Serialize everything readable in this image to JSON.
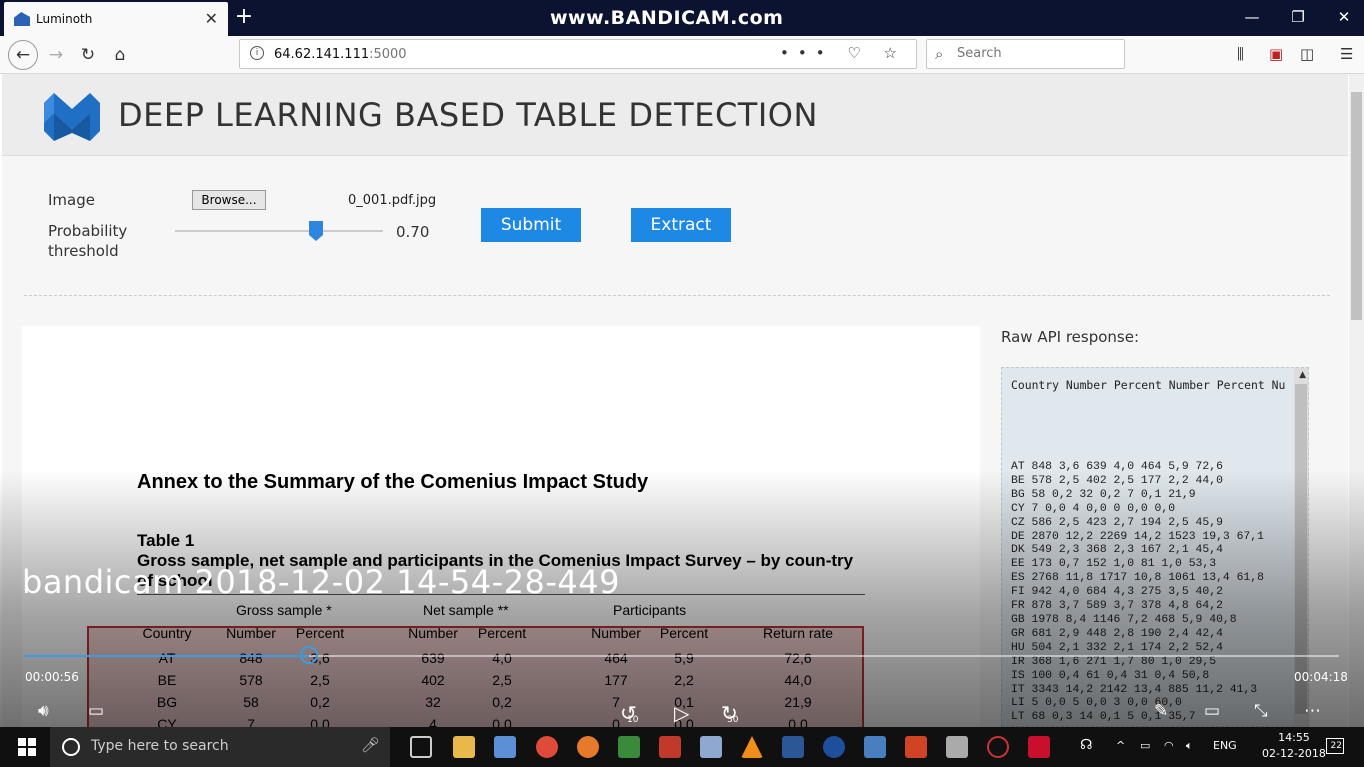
{
  "browser": {
    "tab_title": "Luminoth",
    "tab_close": "✕",
    "new_tab": "+",
    "watermark": "www.BANDICAM.com",
    "win_min": "—",
    "win_max": "❐",
    "win_close": "✕",
    "url_host": "64.62.141.111",
    "url_port": ":5000",
    "url_actions": "••• ♡ ☆",
    "search_placeholder": "Search"
  },
  "app": {
    "title": "DEEP LEARNING BASED TABLE DETECTION",
    "image_label": "Image",
    "browse_label": "Browse...",
    "filename": "0_001.pdf.jpg",
    "threshold_label_1": "Probability",
    "threshold_label_2": "threshold",
    "threshold_value": "0.70",
    "threshold_fraction": 0.7,
    "submit_label": "Submit",
    "extract_label": "Extract",
    "raw_title": "Raw API response:",
    "raw_header": "Country Number Percent Number Percent Nu",
    "raw_lines": [
      "AT 848 3,6 639 4,0 464 5,9 72,6",
      "BE 578 2,5 402 2,5 177 2,2 44,0",
      "BG 58 0,2 32 0,2 7 0,1 21,9",
      "CY 7 0,0 4 0,0 0 0,0 0,0",
      "CZ 586 2,5 423 2,7 194 2,5 45,9",
      "DE 2870 12,2 2269 14,2 1523 19,3 67,1",
      "DK 549 2,3 368 2,3 167 2,1 45,4",
      "EE 173 0,7 152 1,0 81 1,0 53,3",
      "ES 2768 11,8 1717 10,8 1061 13,4 61,8",
      "FI 942 4,0 684 4,3 275 3,5 40,2",
      "FR 878 3,7 589 3,7 378 4,8 64,2",
      "GB 1978 8,4 1146 7,2 468 5,9 40,8",
      "GR 681 2,9 448 2,8 190 2,4 42,4",
      "HU 504 2,1 332 2,1 174 2,2 52,4",
      "IR 368 1,6 271 1,7 80 1,0 29,5",
      "IS 100 0,4 61 0,4 31 0,4 50,8",
      "IT 3343 14,2 2142 13,4 885 11,2 41,3",
      "LI 5 0,0 5 0,0 3 0,0 60,0",
      "LT 68 0,3 14 0,1 5 0,1 35,7"
    ]
  },
  "document": {
    "annex_title": "Annex to the Summary of the Comenius Impact Study",
    "table_no": "Table 1",
    "table_desc": "Gross sample, net sample and participants in the Comenius Impact Survey – by coun-try of school",
    "groups": [
      "Gross sample *",
      "Net sample **",
      "Participants"
    ],
    "columns": [
      "Country",
      "Number",
      "Percent",
      "Number",
      "Percent",
      "Number",
      "Percent",
      "Return rate"
    ],
    "rows": [
      [
        "AT",
        "848",
        "3,6",
        "639",
        "4,0",
        "464",
        "5,9",
        "72,6"
      ],
      [
        "BE",
        "578",
        "2,5",
        "402",
        "2,5",
        "177",
        "2,2",
        "44,0"
      ],
      [
        "BG",
        "58",
        "0,2",
        "32",
        "0,2",
        "7",
        "0,1",
        "21,9"
      ],
      [
        "CY",
        "7",
        "0,0",
        "4",
        "0,0",
        "0",
        "0,0",
        "0,0"
      ]
    ]
  },
  "video": {
    "title": "bandicam 2018-12-02 14-54-28-449",
    "elapsed": "00:00:56",
    "total": "00:04:18",
    "progress": 0.217,
    "rewind_label": "10",
    "forward_label": "30"
  },
  "taskbar": {
    "search_placeholder": "Type here to search",
    "lang": "ENG",
    "time": "14:55",
    "date": "02-12-2018",
    "notifications": "22"
  },
  "colors": {
    "accent": "#1e88e5",
    "titlebar": "#0c1330",
    "detection_box": "#b33333"
  }
}
